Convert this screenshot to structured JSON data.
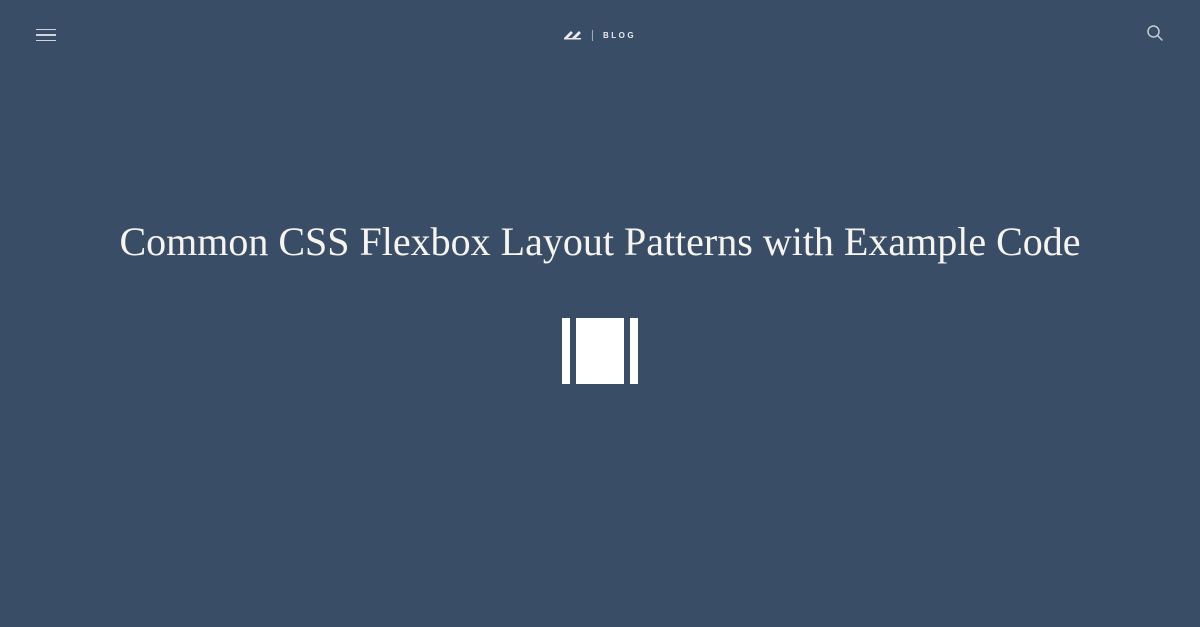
{
  "header": {
    "brand_text": "BLOG"
  },
  "content": {
    "title": "Common CSS Flexbox Layout Patterns with Example Code"
  }
}
